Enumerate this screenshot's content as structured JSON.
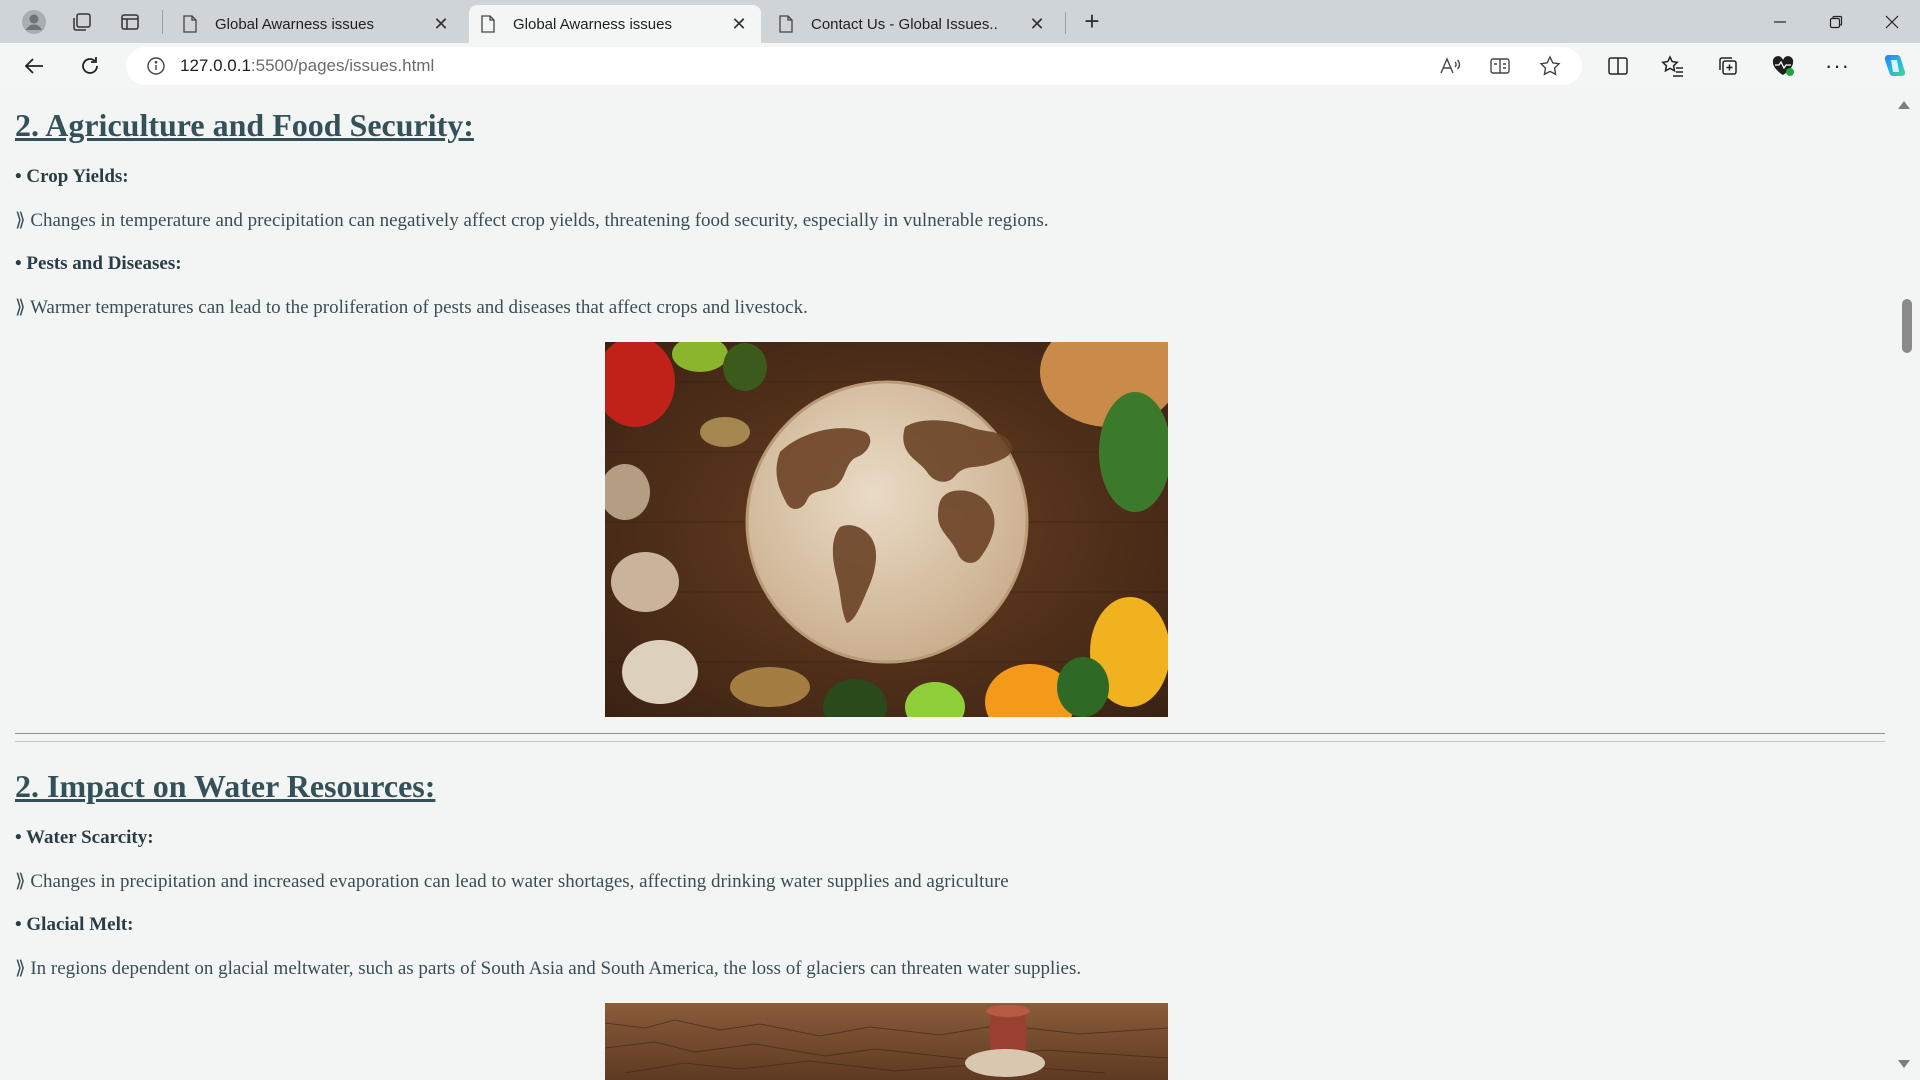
{
  "tabs": [
    {
      "title": "Global Awarness issues",
      "active": false
    },
    {
      "title": "Global Awarness issues",
      "active": true
    },
    {
      "title": "Contact Us - Global Issues..",
      "active": false
    }
  ],
  "address": {
    "host": "127.0.0.1",
    "path": ":5500/pages/issues.html"
  },
  "sections": [
    {
      "heading": "2. Agriculture and Food Security:",
      "items": [
        {
          "label": "• Crop Yields:",
          "text": "⟫ Changes in temperature and precipitation can negatively affect crop yields, threatening food security, especially in vulnerable regions."
        },
        {
          "label": "• Pests and Diseases:",
          "text": "⟫ Warmer temperatures can lead to the proliferation of pests and diseases that affect crops and livestock."
        }
      ]
    },
    {
      "heading": "2. Impact on Water Resources:",
      "items": [
        {
          "label": "• Water Scarcity:",
          "text": "⟫ Changes in precipitation and increased evaporation can lead to water shortages, affecting drinking water supplies and agriculture"
        },
        {
          "label": "• Glacial Melt:",
          "text": "⟫ In regions dependent on glacial meltwater, such as parts of South Asia and South America, the loss of glaciers can threaten water supplies."
        }
      ]
    }
  ],
  "colors": {
    "heading": "#34515a",
    "body_text": "#3a4d55",
    "page_bg": "#f2f5f3"
  }
}
